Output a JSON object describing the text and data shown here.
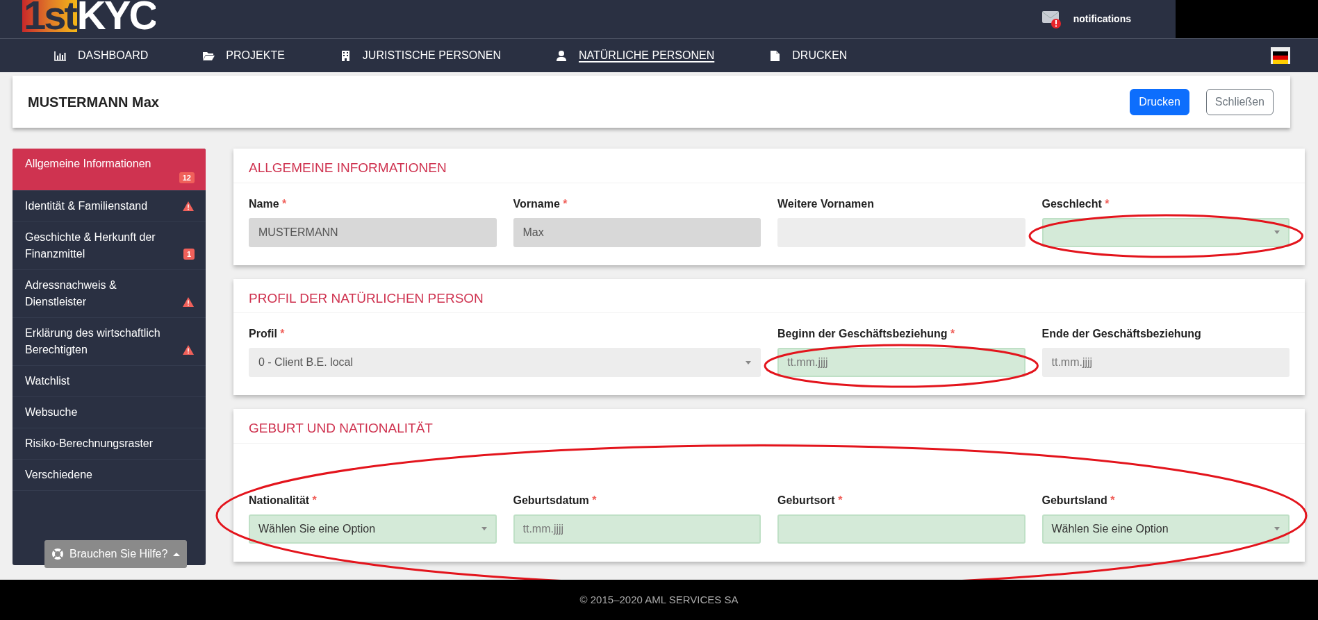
{
  "logo": {
    "prefix": "1st",
    "suffix": "KYC"
  },
  "notifications": {
    "label": "notifications",
    "alert": true
  },
  "nav": [
    {
      "label": "DASHBOARD",
      "selected": false
    },
    {
      "label": "PROJEKTE",
      "selected": false
    },
    {
      "label": "JURISTISCHE PERSONEN",
      "selected": false
    },
    {
      "label": "NATÜRLICHE PERSONEN",
      "selected": true
    },
    {
      "label": "DRUCKEN",
      "selected": false
    }
  ],
  "header": {
    "title": "MUSTERMANN Max",
    "buttons": [
      {
        "label": "Drucken",
        "kind": "primary"
      },
      {
        "label": "Schließen",
        "kind": "outline"
      }
    ]
  },
  "sidebar": {
    "items": [
      {
        "label": "Allgemeine Informationen",
        "badge": "12",
        "selected": true
      },
      {
        "label": "Identität & Familienstand",
        "warning": true,
        "selected": false
      },
      {
        "label": "Geschichte & Herkunft der Finanzmittel",
        "badge": "1",
        "selected": false
      },
      {
        "label": "Adressnachweis & Dienstleister",
        "warning": true,
        "selected": false
      },
      {
        "label": "Erklärung des wirtschaftlich Berechtigten",
        "warning": true,
        "selected": false
      },
      {
        "label": "Watchlist",
        "selected": false
      },
      {
        "label": "Websuche",
        "selected": false
      },
      {
        "label": "Risiko-Berechnungsraster",
        "selected": false
      },
      {
        "label": "Verschiedene",
        "selected": false
      }
    ]
  },
  "help": {
    "label": "Brauchen Sie Hilfe?"
  },
  "sections": [
    {
      "title": "ALLGEMEINE INFORMATIONEN",
      "fields": [
        {
          "label": "Name",
          "required_mark": "*",
          "kind": "input",
          "readonly": true,
          "value": "MUSTERMANN"
        },
        {
          "label": "Vorname",
          "required_mark": "*",
          "kind": "input",
          "readonly": true,
          "value": "Max"
        },
        {
          "label": "Weitere Vornamen",
          "kind": "input",
          "disabled": true
        },
        {
          "label": "Geschlecht",
          "required_mark": "*",
          "kind": "select",
          "valid": true,
          "highlighted": true
        }
      ]
    },
    {
      "title": "PROFIL DER NATÜRLICHEN PERSON",
      "fields": [
        {
          "label": "Profil",
          "required_mark": "*",
          "kind": "wide-select",
          "disabled": true,
          "value": "0 - Client B.E. local"
        },
        {
          "label": "Beginn der Geschäftsbeziehung",
          "required_mark": "*",
          "kind": "input",
          "valid": true,
          "placeholder": "tt.mm.jjjj",
          "highlighted": true
        },
        {
          "label": "Ende der Geschäftsbeziehung",
          "kind": "input",
          "disabled": true,
          "placeholder": "tt.mm.jjjj"
        }
      ]
    },
    {
      "title": "GEBURT UND NATIONALITÄT",
      "highlighted": true,
      "fields": [
        {
          "label": "Nationalität",
          "required_mark": "*",
          "kind": "select",
          "valid": true,
          "value": "Wählen Sie eine Option"
        },
        {
          "label": "Geburtsdatum",
          "required_mark": "*",
          "kind": "input",
          "valid": true,
          "placeholder": "tt.mm.jjjj"
        },
        {
          "label": "Geburtsort",
          "required_mark": "*",
          "kind": "input",
          "valid": true
        },
        {
          "label": "Geburtsland",
          "required_mark": "*",
          "kind": "select",
          "valid": true,
          "value": "Wählen Sie eine Option"
        }
      ]
    }
  ],
  "footer": "© 2015–2020 AML SERVICES SA"
}
